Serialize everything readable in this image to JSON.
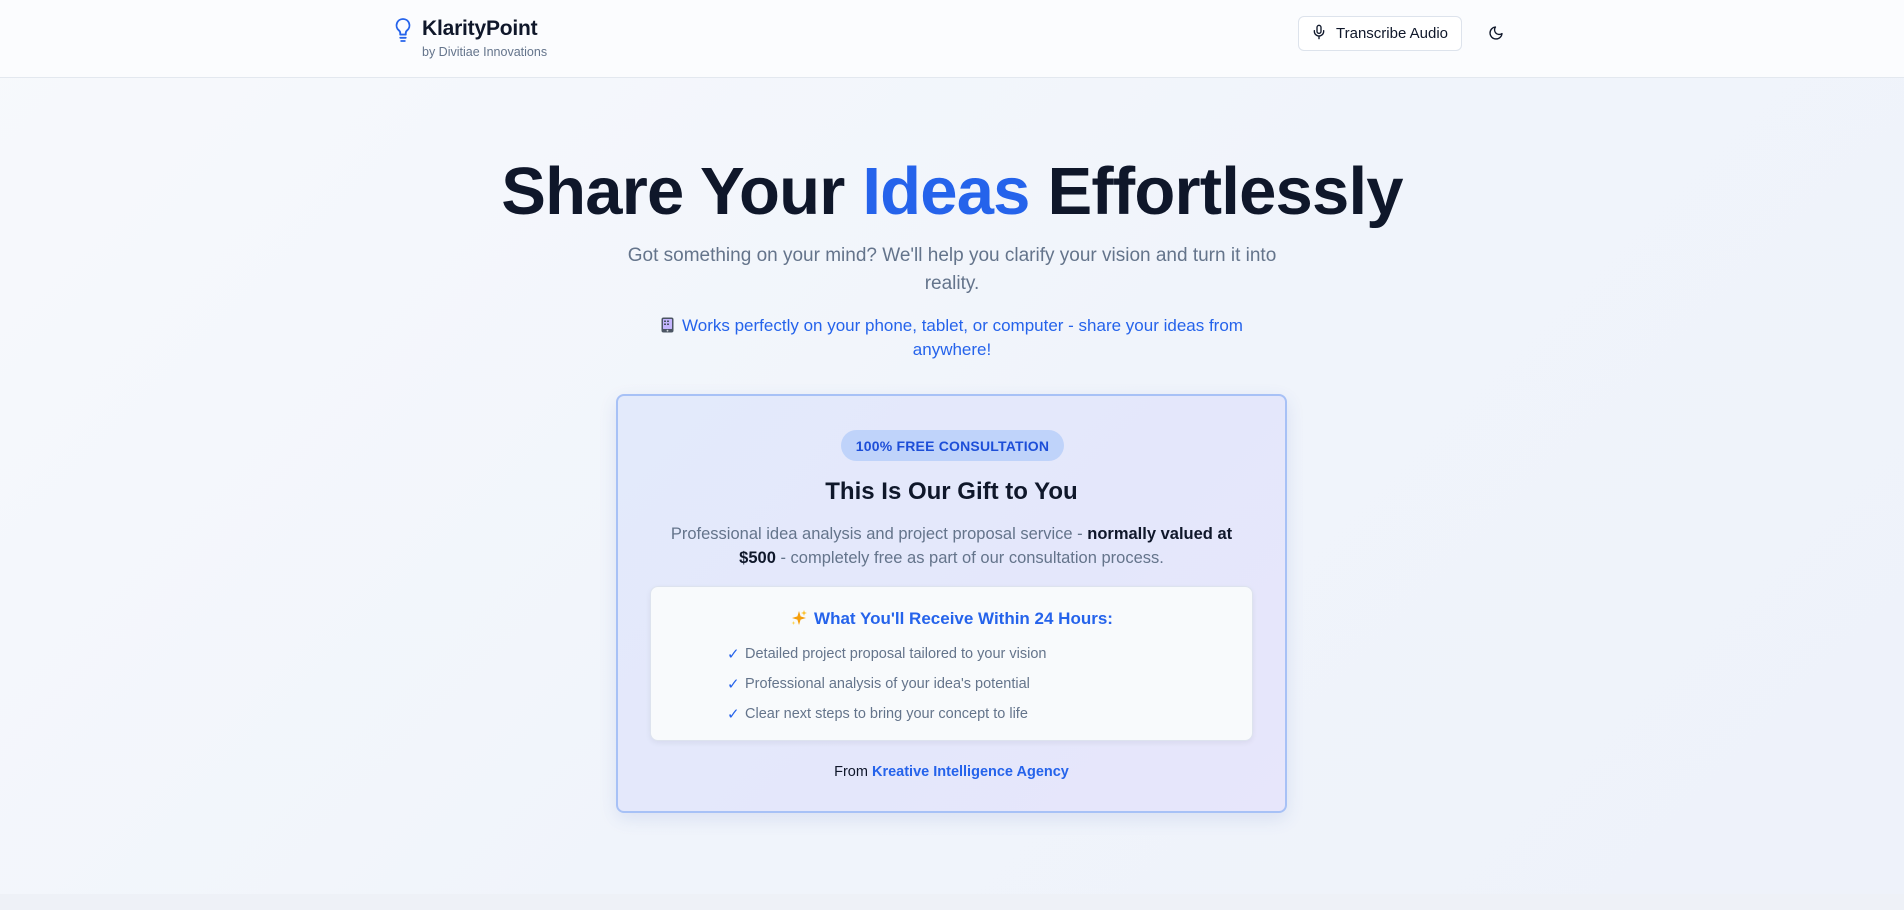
{
  "header": {
    "brand_name": "KlarityPoint",
    "brand_sub": "by Divitiae Innovations",
    "transcribe_label": "Transcribe Audio"
  },
  "hero": {
    "title_part1": "Share Your ",
    "title_accent": "Ideas",
    "title_part2": " Effortlessly",
    "subtitle": "Got something on your mind? We'll help you clarify your vision and turn it into reality.",
    "device_note": "Works perfectly on your phone, tablet, or computer - share your ideas from anywhere!"
  },
  "offer": {
    "badge": "100% FREE CONSULTATION",
    "title": "This Is Our Gift to You",
    "desc_part1": "Professional idea analysis and project proposal service - ",
    "desc_strong": "normally valued at $500",
    "desc_part2": " - completely free as part of our consultation process.",
    "receive_title": "What You'll Receive Within 24 Hours:",
    "items": [
      "Detailed project proposal tailored to your vision",
      "Professional analysis of your idea's potential",
      "Clear next steps to bring your concept to life"
    ],
    "check_glyph": "✓",
    "from_label": "From ",
    "from_link": "Kreative Intelligence Agency"
  },
  "icons": {
    "brand": "lightbulb-icon",
    "transcribe": "microphone-icon",
    "theme": "moon-icon",
    "device": "mobile-phone-icon",
    "receive": "sparkles-icon"
  },
  "colors": {
    "accent": "#2563eb",
    "text_dark": "#0f172a",
    "text_muted": "#64748b",
    "badge_bg": "#bfd3fa",
    "card_border": "#a7c1f6"
  }
}
